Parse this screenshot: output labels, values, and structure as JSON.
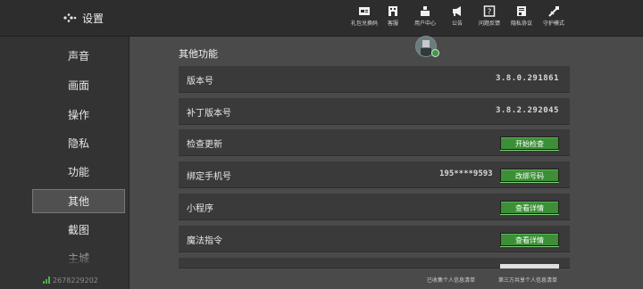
{
  "header": {
    "title": "设置",
    "icons": [
      {
        "label": "礼包兑换码",
        "icon": "gift-code-icon"
      },
      {
        "label": "客服",
        "icon": "customer-service-icon"
      },
      {
        "label": "用户中心",
        "icon": "user-center-icon"
      },
      {
        "label": "公告",
        "icon": "announcement-icon"
      },
      {
        "label": "问题反馈",
        "icon": "feedback-icon"
      },
      {
        "label": "隐私协议",
        "icon": "privacy-icon"
      },
      {
        "label": "守护模式",
        "icon": "guard-mode-icon"
      }
    ]
  },
  "sidebar": {
    "items": [
      {
        "label": "声音"
      },
      {
        "label": "画面"
      },
      {
        "label": "操作"
      },
      {
        "label": "隐私"
      },
      {
        "label": "功能"
      },
      {
        "label": "其他",
        "active": true
      },
      {
        "label": "截图"
      },
      {
        "label": "主城"
      }
    ],
    "user_id": "2678229202"
  },
  "main": {
    "section_title": "其他功能",
    "rows": [
      {
        "label": "版本号",
        "value": "3.8.0.291861"
      },
      {
        "label": "补丁版本号",
        "value": "3.8.2.292045"
      },
      {
        "label": "检查更新",
        "button": "开始检查"
      },
      {
        "label": "绑定手机号",
        "phone": "195****9593",
        "button": "改绑号码"
      },
      {
        "label": "小程序",
        "button": "查看详情"
      },
      {
        "label": "魔法指令",
        "button": "查看详情"
      }
    ],
    "footer": {
      "collected_info": "已收集个人信息清单",
      "third_party_info": "第三方共享个人信息清单"
    }
  },
  "colors": {
    "topbar_bg": "#2d2d2d",
    "sidebar_bg": "#333333",
    "main_bg": "#4a4a4a",
    "row_bg": "#3a3a3a",
    "button_green": "#3c8f37"
  }
}
